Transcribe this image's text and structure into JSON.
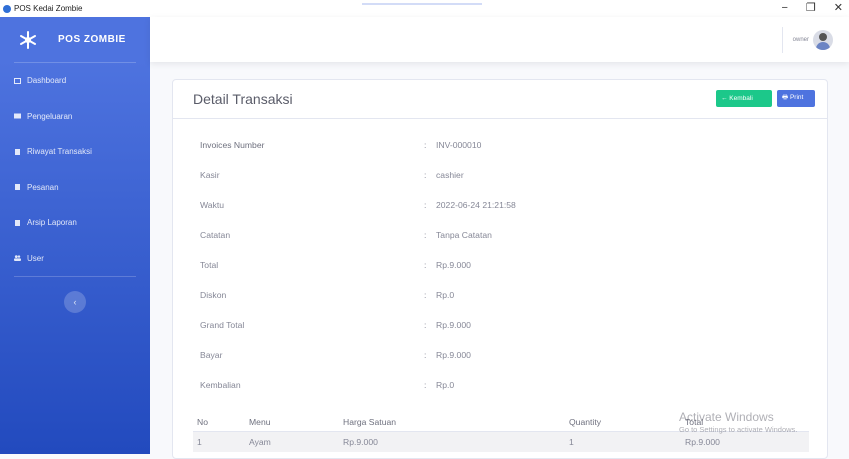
{
  "window": {
    "title": "POS Kedai Zombie",
    "controls": [
      "−",
      "❐",
      "✕"
    ]
  },
  "sidebar": {
    "brand": "POS ZOMBIE",
    "items": [
      {
        "label": "Dashboard",
        "icon": "dashboard-icon"
      },
      {
        "label": "Pengeluaran",
        "icon": "expense-icon"
      },
      {
        "label": "Riwayat Transaksi",
        "icon": "document-icon"
      },
      {
        "label": "Pesanan",
        "icon": "document-icon"
      },
      {
        "label": "Arsip Laporan",
        "icon": "document-icon"
      },
      {
        "label": "User",
        "icon": "users-icon"
      }
    ],
    "toggle": "‹"
  },
  "topbar": {
    "user": "owner"
  },
  "card": {
    "title": "Detail Transaksi",
    "back_label": "← Kembali",
    "print_label": "🖶 Print"
  },
  "details": [
    {
      "label": "Invoices Number",
      "value": "INV-000010"
    },
    {
      "label": "Kasir",
      "value": "cashier"
    },
    {
      "label": "Waktu",
      "value": "2022-06-24 21:21:58"
    },
    {
      "label": "Catatan",
      "value": "Tanpa Catatan"
    },
    {
      "label": "Total",
      "value": "Rp.9.000"
    },
    {
      "label": "Diskon",
      "value": "Rp.0"
    },
    {
      "label": "Grand Total",
      "value": "Rp.9.000"
    },
    {
      "label": "Bayar",
      "value": "Rp.9.000"
    },
    {
      "label": "Kembalian",
      "value": "Rp.0"
    }
  ],
  "separator": ":",
  "items_table": {
    "headers": [
      "No",
      "Menu",
      "Harga Satuan",
      "Quantity",
      "Total"
    ],
    "rows": [
      [
        "1",
        "Ayam",
        "Rp.9.000",
        "1",
        "Rp.9.000"
      ]
    ]
  },
  "watermark": {
    "line1": "Activate Windows",
    "line2": "Go to Settings to activate Windows."
  }
}
